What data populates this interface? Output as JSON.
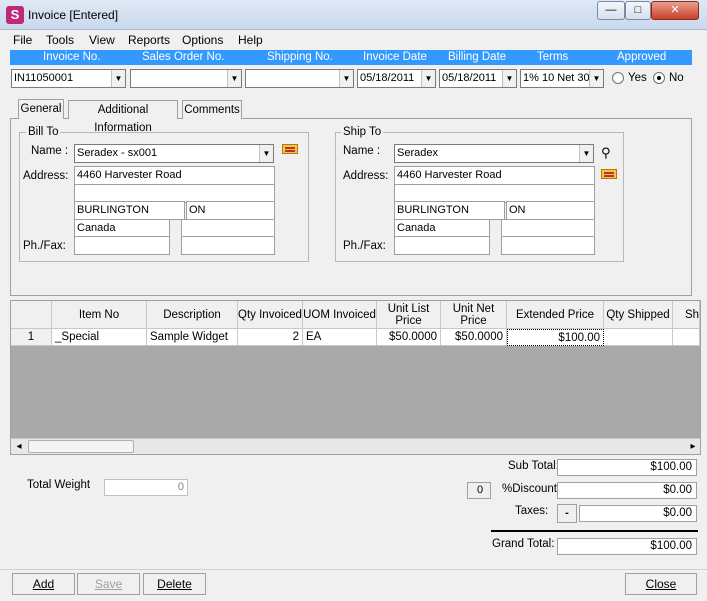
{
  "window": {
    "title": "Invoice [Entered]",
    "min": "—",
    "max": "□",
    "close": "✕"
  },
  "menu": [
    "File",
    "Tools",
    "View",
    "Reports",
    "Options",
    "Help"
  ],
  "header": {
    "cols": [
      "Invoice No.",
      "Sales Order No.",
      "Shipping No.",
      "Invoice Date",
      "Billing Date",
      "Terms",
      "Approved"
    ],
    "invoice_no": "IN11050001",
    "sales_order_no": "",
    "shipping_no": "",
    "invoice_date": "05/18/2011",
    "billing_date": "05/18/2011",
    "terms": "1% 10 Net 30",
    "approved_yes": "Yes",
    "approved_no": "No"
  },
  "tabs": [
    "General",
    "Additional Information",
    "Comments"
  ],
  "bill_to": {
    "legend": "Bill To",
    "name_label": "Name :",
    "name": "Seradex - sx001",
    "address_label": "Address:",
    "address1": "4460 Harvester Road",
    "address2": "",
    "city": "BURLINGTON",
    "province": "ON",
    "country": "Canada",
    "phfax_label": "Ph./Fax:"
  },
  "ship_to": {
    "legend": "Ship To",
    "name_label": "Name :",
    "name": "Seradex",
    "address_label": "Address:",
    "address1": "4460 Harvester Road",
    "address2": "",
    "city": "BURLINGTON",
    "province": "ON",
    "country": "Canada",
    "phfax_label": "Ph./Fax:"
  },
  "grid": {
    "headers": [
      "Item No",
      "Description",
      "Qty Invoiced",
      "UOM Invoiced",
      "Unit List Price",
      "Unit Net Price",
      "Extended Price",
      "Qty Shipped",
      "Sh"
    ],
    "row": {
      "num": "1",
      "item_no": "_Special",
      "description": "Sample Widget",
      "qty_invoiced": "2",
      "uom": "EA",
      "unit_list": "$50.0000",
      "unit_net": "$50.0000",
      "extended": "$100.00",
      "qty_shipped": ""
    }
  },
  "scroll": {
    "left": "◂",
    "right": "▸"
  },
  "totals": {
    "weight_label": "Total Weight",
    "weight": "0",
    "discount_count": "0",
    "subtotal_label": "Sub Total:",
    "subtotal": "$100.00",
    "discount_label": "%Discount:",
    "discount": "$0.00",
    "taxes_label": "Taxes:",
    "taxes_btn": "-",
    "taxes": "$0.00",
    "grand_label": "Grand Total:",
    "grand": "$100.00"
  },
  "buttons": {
    "add": "Add",
    "save": "Save",
    "delete": "Delete",
    "close": "Close"
  }
}
